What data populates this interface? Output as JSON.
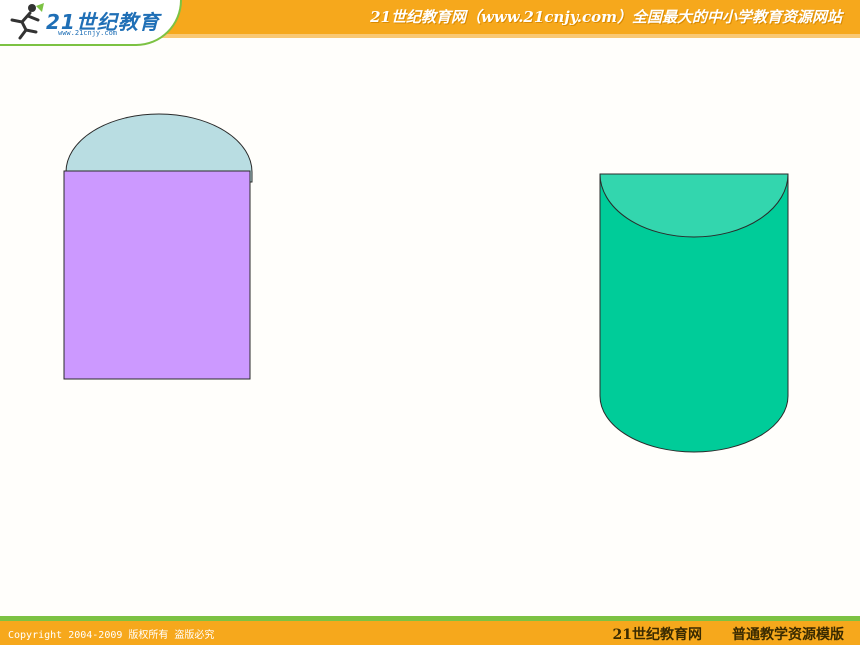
{
  "header": {
    "logo_text": "21世纪教育",
    "logo_url": "www.21cnjy.com",
    "title": "21世纪教育网（www.21cnjy.com）全国最大的中小学教育资源网站"
  },
  "footer": {
    "copyright": "Copyright 2004-2009 版权所有 盗版必究",
    "brand": "21世纪教育网",
    "template": "普通教学资源模版"
  },
  "colors": {
    "header_bg": "#f6a81c",
    "accent_green": "#7cc243",
    "left_cap": "#b9dde2",
    "left_body": "#cc99ff",
    "cylinder_body": "#00cc99",
    "cylinder_top": "#33d6ae"
  }
}
